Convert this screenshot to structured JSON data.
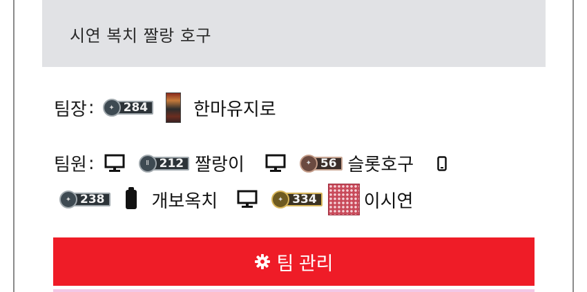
{
  "team": {
    "name": "시연 복치 짤랑 호구"
  },
  "leader": {
    "label": "팀장",
    "colon": ":",
    "level": "284",
    "name": "한마유지로"
  },
  "members": {
    "label": "팀원",
    "colon": ":",
    "list": [
      {
        "platform_icon": "monitor-icon",
        "level": "212",
        "tier": "silver",
        "name": "짤랑이"
      },
      {
        "platform_icon": "monitor-icon",
        "level": "56",
        "tier": "bronze",
        "name": "슬롯호구"
      },
      {
        "platform_icon": "phone-icon",
        "level": "238",
        "tier": "silver",
        "name": "개보옥치"
      },
      {
        "platform_icon": "monitor-icon",
        "level": "334",
        "tier": "gold",
        "name": "이시연"
      }
    ]
  },
  "actions": {
    "manage_label": "팀 관리",
    "manage_icon": "gear-icon"
  },
  "colors": {
    "button_red": "#ef1c27",
    "header_gray": "#e1e2e5"
  }
}
